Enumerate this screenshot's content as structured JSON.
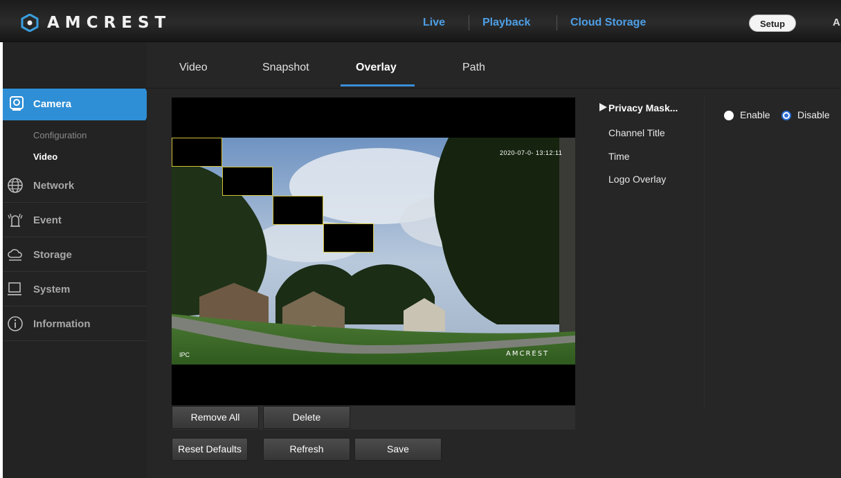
{
  "header": {
    "brand": "AMCREST",
    "nav": {
      "live": "Live",
      "playback": "Playback",
      "cloud_storage": "Cloud Storage",
      "setup": "Setup",
      "truncated": "A"
    }
  },
  "sidebar": {
    "active": {
      "label": "Camera",
      "sub_items": [
        "Configuration",
        "Video"
      ]
    },
    "items": [
      {
        "label": "Network",
        "icon": "network-globe-icon"
      },
      {
        "label": "Event",
        "icon": "event-bell-icon"
      },
      {
        "label": "Storage",
        "icon": "storage-cloud-icon"
      },
      {
        "label": "System",
        "icon": "system-monitor-icon"
      },
      {
        "label": "Information",
        "icon": "information-icon"
      }
    ]
  },
  "tabs": [
    "Video",
    "Snapshot",
    "Overlay",
    "Path"
  ],
  "active_tab": "Overlay",
  "preview": {
    "timestamp": "2020-07-0- 13:12:11",
    "channel_label": "IPC",
    "watermark": "AMCREST"
  },
  "buttons": {
    "remove_all": "Remove All",
    "delete": "Delete",
    "reset_defaults": "Reset Defaults",
    "refresh": "Refresh",
    "save": "Save"
  },
  "overlay_menu": [
    "Privacy Mask...",
    "Channel Title",
    "Time",
    "Logo Overlay"
  ],
  "privacy_mask": {
    "enable_label": "Enable",
    "disable_label": "Disable",
    "selected": "Disable"
  },
  "colors": {
    "accent": "#3a8fd8",
    "nav_text": "#4d9fe6",
    "mask_border": "#d3c23a"
  }
}
